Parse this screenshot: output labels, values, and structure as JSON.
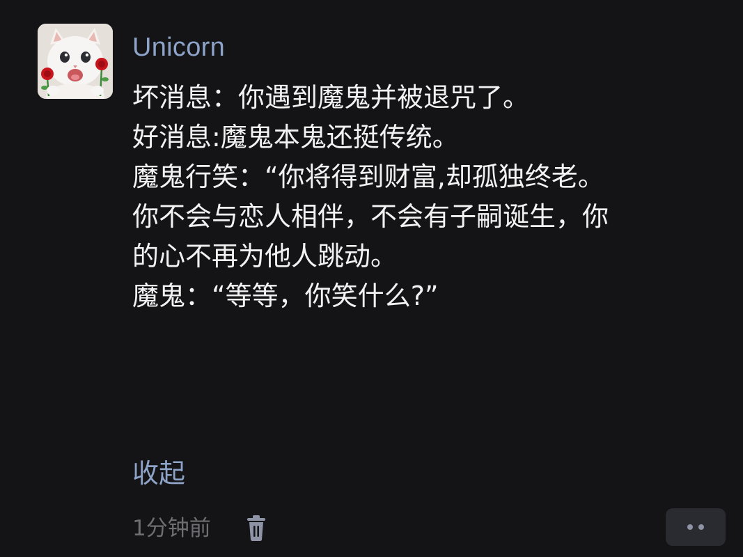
{
  "comment": {
    "username": "Unicorn",
    "paragraphs": [
      "坏消息：你遇到魔鬼并被退咒了。",
      "",
      "好消息:魔鬼本鬼还挺传统。",
      "",
      "魔鬼行笑：“你将得到财富,却孤独终老。\n你不会与恋人相伴，不会有子嗣诞生，你\n的心不再为他人跳动。",
      "",
      "魔鬼：“等等，你笑什么?”"
    ],
    "collapse_label": "收起",
    "timestamp": "1分钟前"
  },
  "icons": {
    "avatar": "cat-avatar-with-roses",
    "delete": "trash-icon",
    "more": "more-dots-icon"
  },
  "colors": {
    "background": "#141416",
    "text": "#f2f2f2",
    "link": "#8da3c8",
    "meta": "#6e6e73",
    "button": "#2a2b31"
  }
}
